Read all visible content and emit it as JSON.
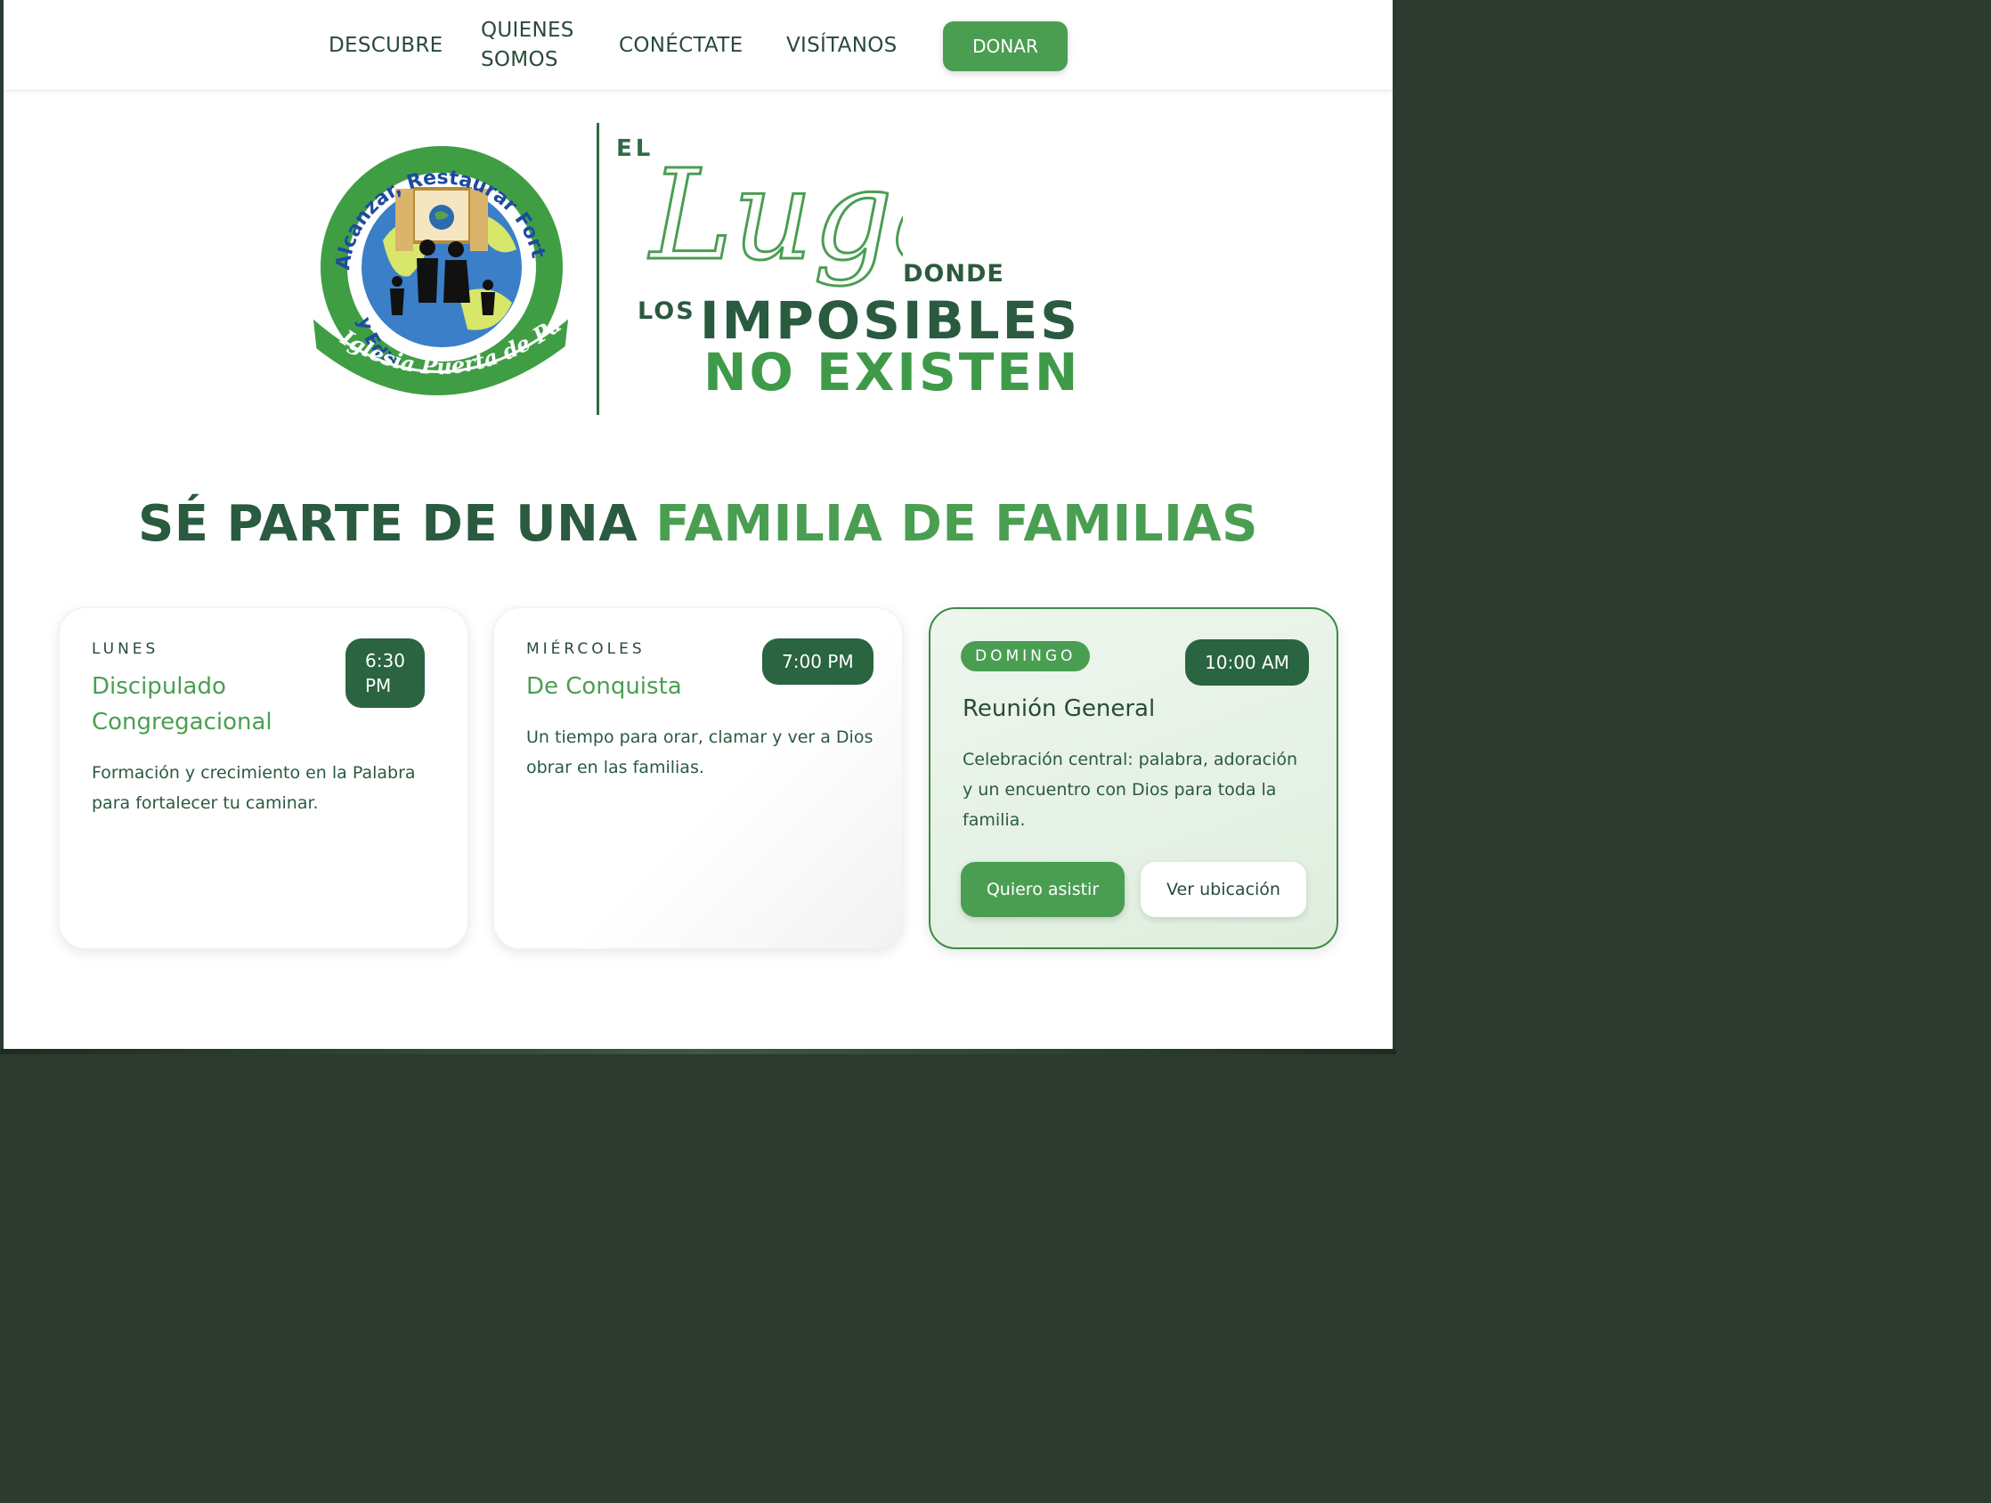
{
  "nav": {
    "items": [
      {
        "label": "DESCUBRE"
      },
      {
        "label": "QUIENES SOMOS",
        "line1": "QUIENES",
        "line2": "SOMOS"
      },
      {
        "label": "CONÉCTATE"
      },
      {
        "label": "VISÍTANOS"
      }
    ],
    "donate_label": "DONAR"
  },
  "logo": {
    "text_top": "Alcanzar, Restaurar Fortalecer",
    "text_bottom": "y Edificar Familias",
    "ribbon": "Iglesia Puerta de Paz"
  },
  "hero": {
    "el": "EL",
    "lugar": "Lugar",
    "donde": "DONDE",
    "los": "LOS",
    "imposibles": "IMPOSIBLES",
    "no_existen": "NO EXISTEN"
  },
  "headline": {
    "part1": "SÉ PARTE DE UNA ",
    "part2": "FAMILIA DE FAMILIAS"
  },
  "cards": [
    {
      "day": "LUNES",
      "time": "6:30 PM",
      "time_line1": "6:30",
      "time_line2": "PM",
      "title": "Discipulado Congregacional",
      "title_line1": "Discipulado",
      "title_line2": "Congregacional",
      "description": "Formación y crecimiento en la Palabra para fortalecer tu caminar.",
      "desc_line1": "Formación y crecimiento en la Palabra",
      "desc_line2": "para fortalecer tu caminar."
    },
    {
      "day": "MIÉRCOLES",
      "time": "7:00 PM",
      "title": "De Conquista",
      "description": "Un tiempo para orar, clamar y ver a Dios obrar en las familias.",
      "desc_line1": "Un tiempo para orar, clamar y ver a Dios",
      "desc_line2": "obrar en las familias."
    },
    {
      "day": "DOMINGO",
      "time": "10:00 AM",
      "title": "Reunión General",
      "description": "Celebración central: palabra, adoración y un encuentro con Dios para toda la familia.",
      "desc_line1": "Celebración central: palabra, adoración",
      "desc_line2": "y un encuentro con Dios para toda la",
      "desc_line3": "familia.",
      "primary_button": "Quiero asistir",
      "secondary_button": "Ver ubicación"
    }
  ],
  "colors": {
    "brand_green": "#4a9e52",
    "dark_green": "#2a6440",
    "text_dark": "#2a4a39"
  }
}
